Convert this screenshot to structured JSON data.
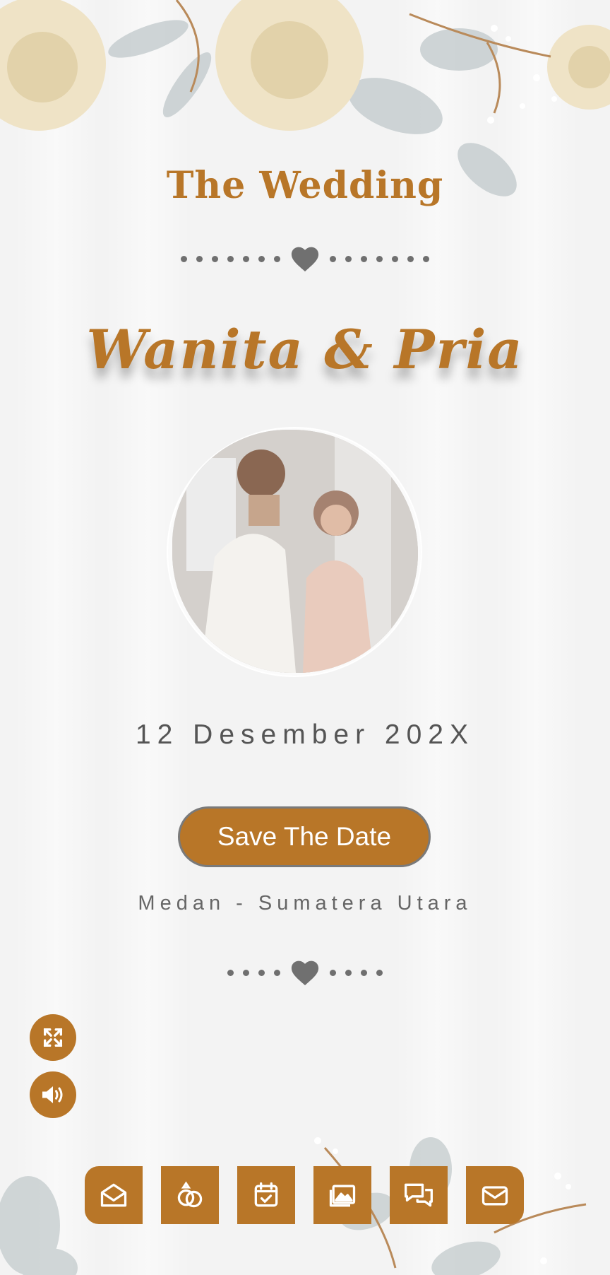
{
  "header": {
    "title": "The Wedding"
  },
  "couple": {
    "names": "Wanita & Pria"
  },
  "event": {
    "date": "12 Desember 202X",
    "save_label": "Save The Date",
    "location": "Medan - Sumatera Utara"
  },
  "controls": {
    "fullscreen_icon": "expand-icon",
    "audio_icon": "speaker-icon"
  },
  "nav": {
    "items": [
      {
        "icon": "envelope-open-icon"
      },
      {
        "icon": "rings-icon"
      },
      {
        "icon": "calendar-check-icon"
      },
      {
        "icon": "gallery-icon"
      },
      {
        "icon": "chat-icon"
      },
      {
        "icon": "mail-icon"
      }
    ]
  },
  "colors": {
    "accent": "#b87628",
    "background": "#f3f3f3",
    "text": "#555555"
  }
}
